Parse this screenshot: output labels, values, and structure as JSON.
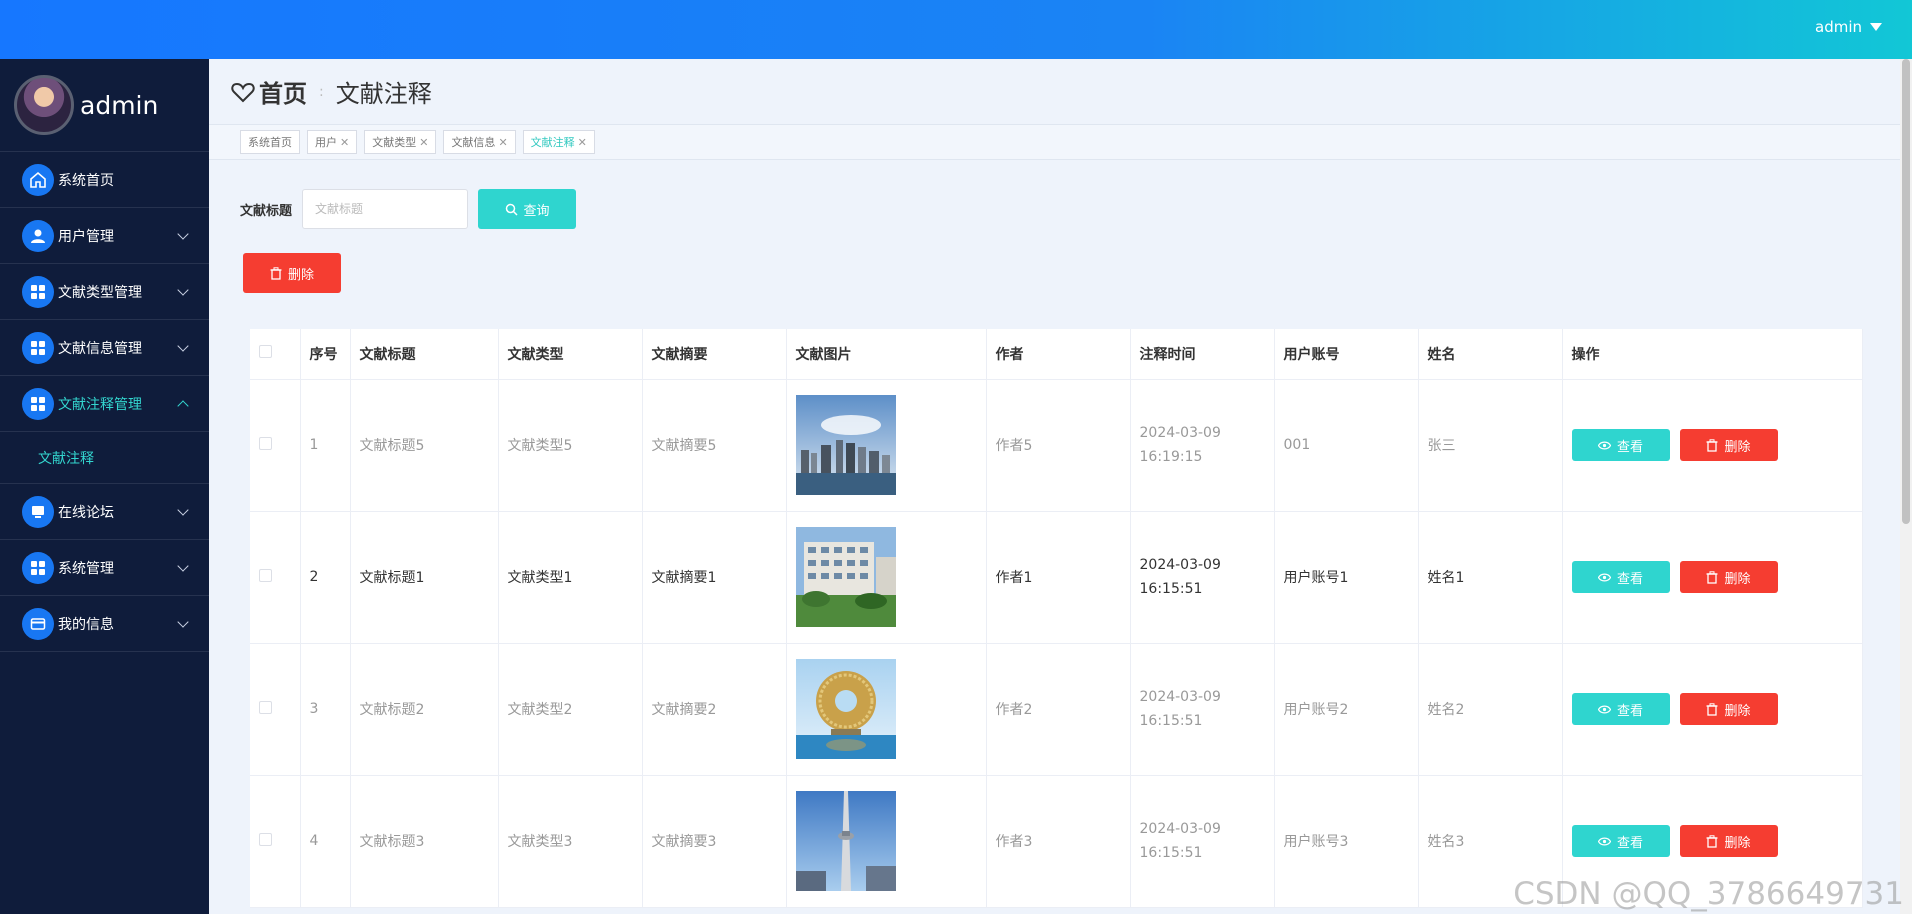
{
  "topbar": {
    "username": "admin"
  },
  "sidebar": {
    "profile_name": "admin",
    "items": [
      {
        "label": "系统首页",
        "icon": "home-icon",
        "expandable": false
      },
      {
        "label": "用户管理",
        "icon": "user-icon",
        "expandable": true
      },
      {
        "label": "文献类型管理",
        "icon": "grid-icon",
        "expandable": true
      },
      {
        "label": "文献信息管理",
        "icon": "grid-icon",
        "expandable": true
      },
      {
        "label": "文献注释管理",
        "icon": "grid-icon",
        "expandable": true,
        "active": true
      },
      {
        "label": "在线论坛",
        "icon": "monitor-icon",
        "expandable": true
      },
      {
        "label": "系统管理",
        "icon": "grid-icon",
        "expandable": true
      },
      {
        "label": "我的信息",
        "icon": "card-icon",
        "expandable": true
      }
    ],
    "submenu": {
      "label": "文献注释"
    }
  },
  "header": {
    "home": "首页",
    "current": "文献注释"
  },
  "tabs": [
    {
      "label": "系统首页",
      "closable": false
    },
    {
      "label": "用户",
      "closable": true
    },
    {
      "label": "文献类型",
      "closable": true
    },
    {
      "label": "文献信息",
      "closable": true
    },
    {
      "label": "文献注释",
      "closable": true,
      "active": true
    }
  ],
  "search": {
    "label": "文献标题",
    "placeholder": "文献标题",
    "query_button": "查询"
  },
  "delete_button": "删除",
  "table": {
    "headers": [
      "序号",
      "文献标题",
      "文献类型",
      "文献摘要",
      "文献图片",
      "作者",
      "注释时间",
      "用户账号",
      "姓名",
      "操作"
    ],
    "rows": [
      {
        "no": "1",
        "title": "文献标题5",
        "type": "文献类型5",
        "abstract": "文献摘要5",
        "author": "作者5",
        "time": "2024-03-09 16:19:15",
        "account": "001",
        "name": "张三",
        "image": "city-skyline",
        "dark": false
      },
      {
        "no": "2",
        "title": "文献标题1",
        "type": "文献类型1",
        "abstract": "文献摘要1",
        "author": "作者1",
        "time": "2024-03-09 16:15:51",
        "account": "用户账号1",
        "name": "姓名1",
        "image": "apartment",
        "dark": true
      },
      {
        "no": "3",
        "title": "文献标题2",
        "type": "文献类型2",
        "abstract": "文献摘要2",
        "author": "作者2",
        "time": "2024-03-09 16:15:51",
        "account": "用户账号2",
        "name": "姓名2",
        "image": "ring-building",
        "dark": false
      },
      {
        "no": "4",
        "title": "文献标题3",
        "type": "文献类型3",
        "abstract": "文献摘要3",
        "author": "作者3",
        "time": "2024-03-09 16:15:51",
        "account": "用户账号3",
        "name": "姓名3",
        "image": "tv-tower",
        "dark": false
      }
    ],
    "view_label": "查看",
    "delete_label": "删除"
  },
  "watermark": "CSDN @QQ_3786649731",
  "colors": {
    "accent": "#2fd5cf",
    "danger": "#f53d31",
    "sidebar": "#0f1c3b",
    "primary": "#1877f2"
  }
}
